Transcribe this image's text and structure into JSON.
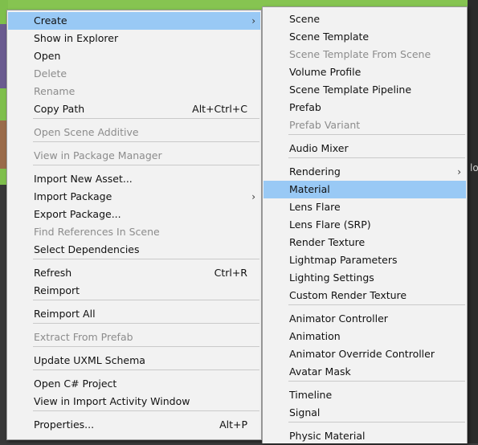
{
  "main_menu": {
    "items": [
      {
        "label": "Create",
        "shortcut": "",
        "submenu": true,
        "disabled": false,
        "highlight": true
      },
      {
        "label": "Show in Explorer",
        "shortcut": "",
        "submenu": false,
        "disabled": false
      },
      {
        "label": "Open",
        "shortcut": "",
        "submenu": false,
        "disabled": false
      },
      {
        "label": "Delete",
        "shortcut": "",
        "submenu": false,
        "disabled": true
      },
      {
        "label": "Rename",
        "shortcut": "",
        "submenu": false,
        "disabled": true
      },
      {
        "label": "Copy Path",
        "shortcut": "Alt+Ctrl+C",
        "submenu": false,
        "disabled": false
      },
      {
        "label": "Open Scene Additive",
        "shortcut": "",
        "submenu": false,
        "disabled": true
      },
      {
        "label": "View in Package Manager",
        "shortcut": "",
        "submenu": false,
        "disabled": true
      },
      {
        "label": "Import New Asset...",
        "shortcut": "",
        "submenu": false,
        "disabled": false
      },
      {
        "label": "Import Package",
        "shortcut": "",
        "submenu": true,
        "disabled": false
      },
      {
        "label": "Export Package...",
        "shortcut": "",
        "submenu": false,
        "disabled": false
      },
      {
        "label": "Find References In Scene",
        "shortcut": "",
        "submenu": false,
        "disabled": true
      },
      {
        "label": "Select Dependencies",
        "shortcut": "",
        "submenu": false,
        "disabled": false
      },
      {
        "label": "Refresh",
        "shortcut": "Ctrl+R",
        "submenu": false,
        "disabled": false
      },
      {
        "label": "Reimport",
        "shortcut": "",
        "submenu": false,
        "disabled": false
      },
      {
        "label": "Reimport All",
        "shortcut": "",
        "submenu": false,
        "disabled": false
      },
      {
        "label": "Extract From Prefab",
        "shortcut": "",
        "submenu": false,
        "disabled": true
      },
      {
        "label": "Update UXML Schema",
        "shortcut": "",
        "submenu": false,
        "disabled": false
      },
      {
        "label": "Open C# Project",
        "shortcut": "",
        "submenu": false,
        "disabled": false
      },
      {
        "label": "View in Import Activity Window",
        "shortcut": "",
        "submenu": false,
        "disabled": false
      },
      {
        "label": "Properties...",
        "shortcut": "Alt+P",
        "submenu": false,
        "disabled": false
      }
    ]
  },
  "sub_menu": {
    "items": [
      {
        "label": "Scene",
        "submenu": false,
        "disabled": false
      },
      {
        "label": "Scene Template",
        "submenu": false,
        "disabled": false
      },
      {
        "label": "Scene Template From Scene",
        "submenu": false,
        "disabled": true
      },
      {
        "label": "Volume Profile",
        "submenu": false,
        "disabled": false
      },
      {
        "label": "Scene Template Pipeline",
        "submenu": false,
        "disabled": false
      },
      {
        "label": "Prefab",
        "submenu": false,
        "disabled": false
      },
      {
        "label": "Prefab Variant",
        "submenu": false,
        "disabled": true
      },
      {
        "label": "Audio Mixer",
        "submenu": false,
        "disabled": false
      },
      {
        "label": "Rendering",
        "submenu": true,
        "disabled": false
      },
      {
        "label": "Material",
        "submenu": false,
        "disabled": false,
        "highlight": true
      },
      {
        "label": "Lens Flare",
        "submenu": false,
        "disabled": false
      },
      {
        "label": "Lens Flare (SRP)",
        "submenu": false,
        "disabled": false
      },
      {
        "label": "Render Texture",
        "submenu": false,
        "disabled": false
      },
      {
        "label": "Lightmap Parameters",
        "submenu": false,
        "disabled": false
      },
      {
        "label": "Lighting Settings",
        "submenu": false,
        "disabled": false
      },
      {
        "label": "Custom Render Texture",
        "submenu": false,
        "disabled": false
      },
      {
        "label": "Animator Controller",
        "submenu": false,
        "disabled": false
      },
      {
        "label": "Animation",
        "submenu": false,
        "disabled": false
      },
      {
        "label": "Animator Override Controller",
        "submenu": false,
        "disabled": false
      },
      {
        "label": "Avatar Mask",
        "submenu": false,
        "disabled": false
      },
      {
        "label": "Timeline",
        "submenu": false,
        "disabled": false
      },
      {
        "label": "Signal",
        "submenu": false,
        "disabled": false
      },
      {
        "label": "Physic Material",
        "submenu": false,
        "disabled": false
      }
    ]
  },
  "background": {
    "right_panel_text": "lo"
  },
  "colors": {
    "menu_bg": "#f2f2f2",
    "highlight": "#99c9f5",
    "disabled_text": "#8c8c8c"
  },
  "icons": {
    "submenu_arrow": "chevron-right-icon"
  }
}
